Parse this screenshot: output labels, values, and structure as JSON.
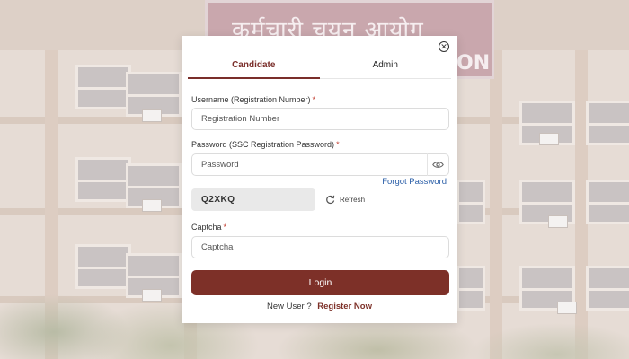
{
  "background": {
    "sign_text_top": "कर्मचारी चयन आयोग",
    "sign_text_bottom": "ON"
  },
  "modal": {
    "tabs": [
      {
        "label": "Candidate",
        "active": true
      },
      {
        "label": "Admin",
        "active": false
      }
    ],
    "username": {
      "label": "Username (Registration Number)",
      "required_mark": "*",
      "placeholder": "Registration Number",
      "value": ""
    },
    "password": {
      "label": "Password (SSC Registration Password)",
      "required_mark": "*",
      "placeholder": "Password",
      "value": ""
    },
    "forgot_password": "Forgot Password",
    "captcha_code": "Q2XKQ",
    "refresh_label": "Refresh",
    "captcha": {
      "label": "Captcha",
      "required_mark": "*",
      "placeholder": "Captcha",
      "value": ""
    },
    "login_label": "Login",
    "new_user_text": "New User ?",
    "register_label": "Register Now"
  },
  "icons": {
    "close": "close-icon",
    "eye": "eye-icon",
    "refresh": "refresh-icon"
  },
  "colors": {
    "accent": "#7d3028",
    "link": "#2b5fa8",
    "required": "#c0392b"
  }
}
